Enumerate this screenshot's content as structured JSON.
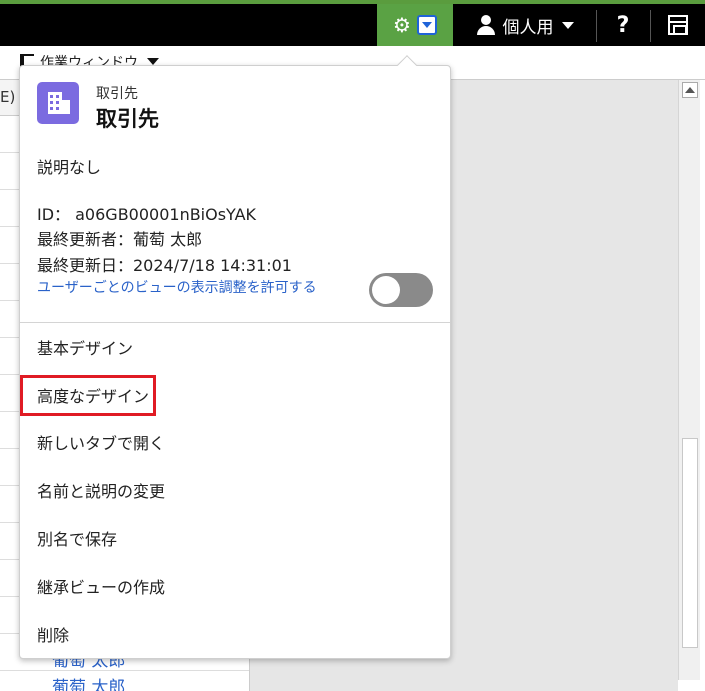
{
  "topbar": {
    "gear_icon": "gear-icon",
    "user_label": "個人用",
    "help_label": "?"
  },
  "bar2": {
    "window_label": "作業ウィンドウ"
  },
  "background": {
    "header_fragment": "E)",
    "row_name_1": "葡萄 太郎",
    "row_name_2": "葡萄 太郎"
  },
  "popup": {
    "object_subtitle": "取引先",
    "object_title": "取引先",
    "description": "説明なし",
    "id_line": "ID： a06GB00001nBiOsYAK",
    "updated_by_line": "最終更新者：葡萄 太郎",
    "updated_at_line": "最終更新日：2024/7/18 14:31:01",
    "allow_link": "ユーザーごとのビューの表示調整を許可する",
    "toggle_on": false,
    "menu": [
      {
        "label": "基本デザイン"
      },
      {
        "label": "高度なデザイン"
      },
      {
        "label": "新しいタブで開く"
      },
      {
        "label": "名前と説明の変更"
      },
      {
        "label": "別名で保存"
      },
      {
        "label": "継承ビューの作成"
      },
      {
        "label": "削除"
      }
    ]
  },
  "colors": {
    "gear_bg": "#5aa244",
    "accent": "#2a62c9",
    "object_icon": "#7b6be0",
    "highlight": "#e01b24"
  }
}
